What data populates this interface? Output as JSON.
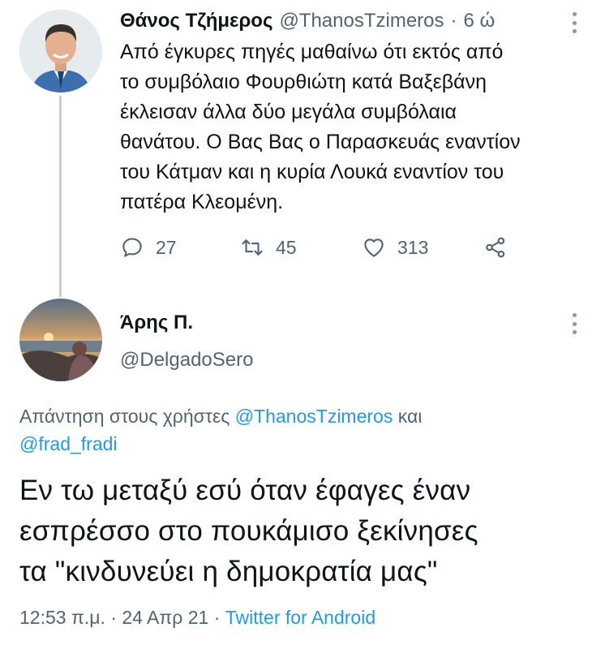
{
  "parent_tweet": {
    "author_name": "Θάνος Τζήμερος",
    "author_handle": "@ThanosTzimeros",
    "separator": "·",
    "time_ago": "6 ώ",
    "text_lines": [
      "Από έγκυρες πηγές μαθαίνω ότι εκτός από",
      "το συμβόλαιο Φουρθιώτη κατά Βαξεβάνη",
      "έκλεισαν άλλα δύο μεγάλα συμβόλαια",
      "θανάτου. Ο Βας Βας ο Παρασκευάς εναντίον",
      "του Κάτμαν και η κυρία Λουκά εναντίον του",
      "πατέρα Κλεομένη."
    ],
    "actions": {
      "reply_count": "27",
      "retweet_count": "45",
      "like_count": "313"
    }
  },
  "reply_tweet": {
    "author_name": "Άρης Π.",
    "author_handle": "@DelgadoSero",
    "replying_to": {
      "prefix": "Απάντηση στους χρήστες",
      "user1": "@ThanosTzimeros",
      "conjunction": "και",
      "user2": "@frad_fradi"
    },
    "text_lines": [
      "Εν τω μεταξύ εσύ όταν έφαγες έναν",
      "εσπρέσσο στο πουκάμισο ξεκίνησες",
      "τα \"κινδυνεύει η δημοκρατία μας\""
    ],
    "time": "12:53 π.μ.",
    "separator1": "·",
    "date": "24 Απρ 21",
    "separator2": "·",
    "source": "Twitter for Android"
  },
  "colors": {
    "text": "#0f1419",
    "secondary": "#536471",
    "link": "#1d9bf0",
    "thread_line": "#c4cfd6"
  }
}
